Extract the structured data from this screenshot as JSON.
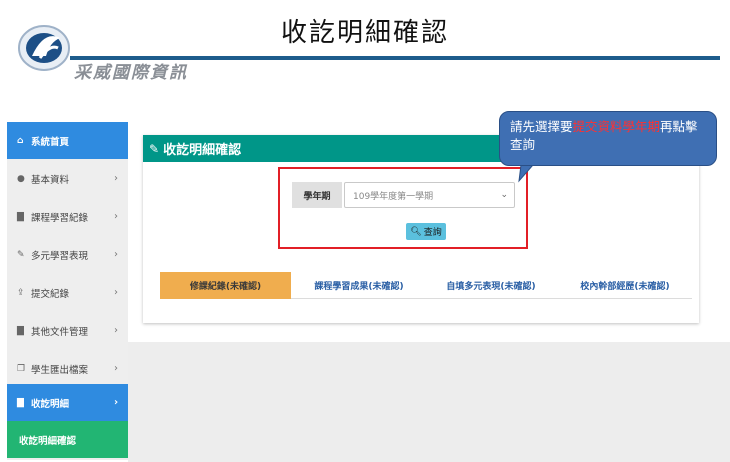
{
  "slide": {
    "title": "收訖明細確認",
    "logo_text": "采威國際資訊"
  },
  "sidebar": {
    "items": [
      {
        "label": "系統首頁",
        "icon": "home-icon",
        "state": "active-home"
      },
      {
        "label": "基本資料",
        "icon": "user-icon",
        "arrow": "›"
      },
      {
        "label": "課程學習紀錄",
        "icon": "book-icon",
        "arrow": "›"
      },
      {
        "label": "多元學習表現",
        "icon": "brush-icon",
        "arrow": "›"
      },
      {
        "label": "提交紀錄",
        "icon": "upload-icon",
        "arrow": "›"
      },
      {
        "label": "其他文件管理",
        "icon": "book-icon",
        "arrow": "›"
      },
      {
        "label": "學生匯出檔案",
        "icon": "copy-icon",
        "arrow": "›"
      },
      {
        "label": "收訖明細",
        "icon": "book-icon",
        "arrow": "›",
        "state": "active-blue"
      },
      {
        "label": "收訖明細確認",
        "state": "active-green"
      }
    ]
  },
  "panel": {
    "title": "收訖明細確認",
    "semester_label": "學年期",
    "semester_value": "109學年度第一學期",
    "query_button": "查詢"
  },
  "tabs": [
    {
      "label": "修課紀錄(未確認)",
      "active": true
    },
    {
      "label": "課程學習成果(未確認)",
      "active": false
    },
    {
      "label": "自填多元表現(未確認)",
      "active": false
    },
    {
      "label": "校內幹部經歷(未確認)",
      "active": false
    }
  ],
  "callout": {
    "text_before": "請先選擇要",
    "text_highlight": "提交資料學年期",
    "text_after": "再點擊查詢"
  },
  "colors": {
    "sidebar_active": "#2f8be0",
    "sidebar_sub_active": "#22b573",
    "panel_header": "#009688",
    "tab_active": "#f0ad4e",
    "query_button": "#5bc0de",
    "highlight_box": "#e21f26",
    "callout_bg": "#3f6fb3"
  }
}
